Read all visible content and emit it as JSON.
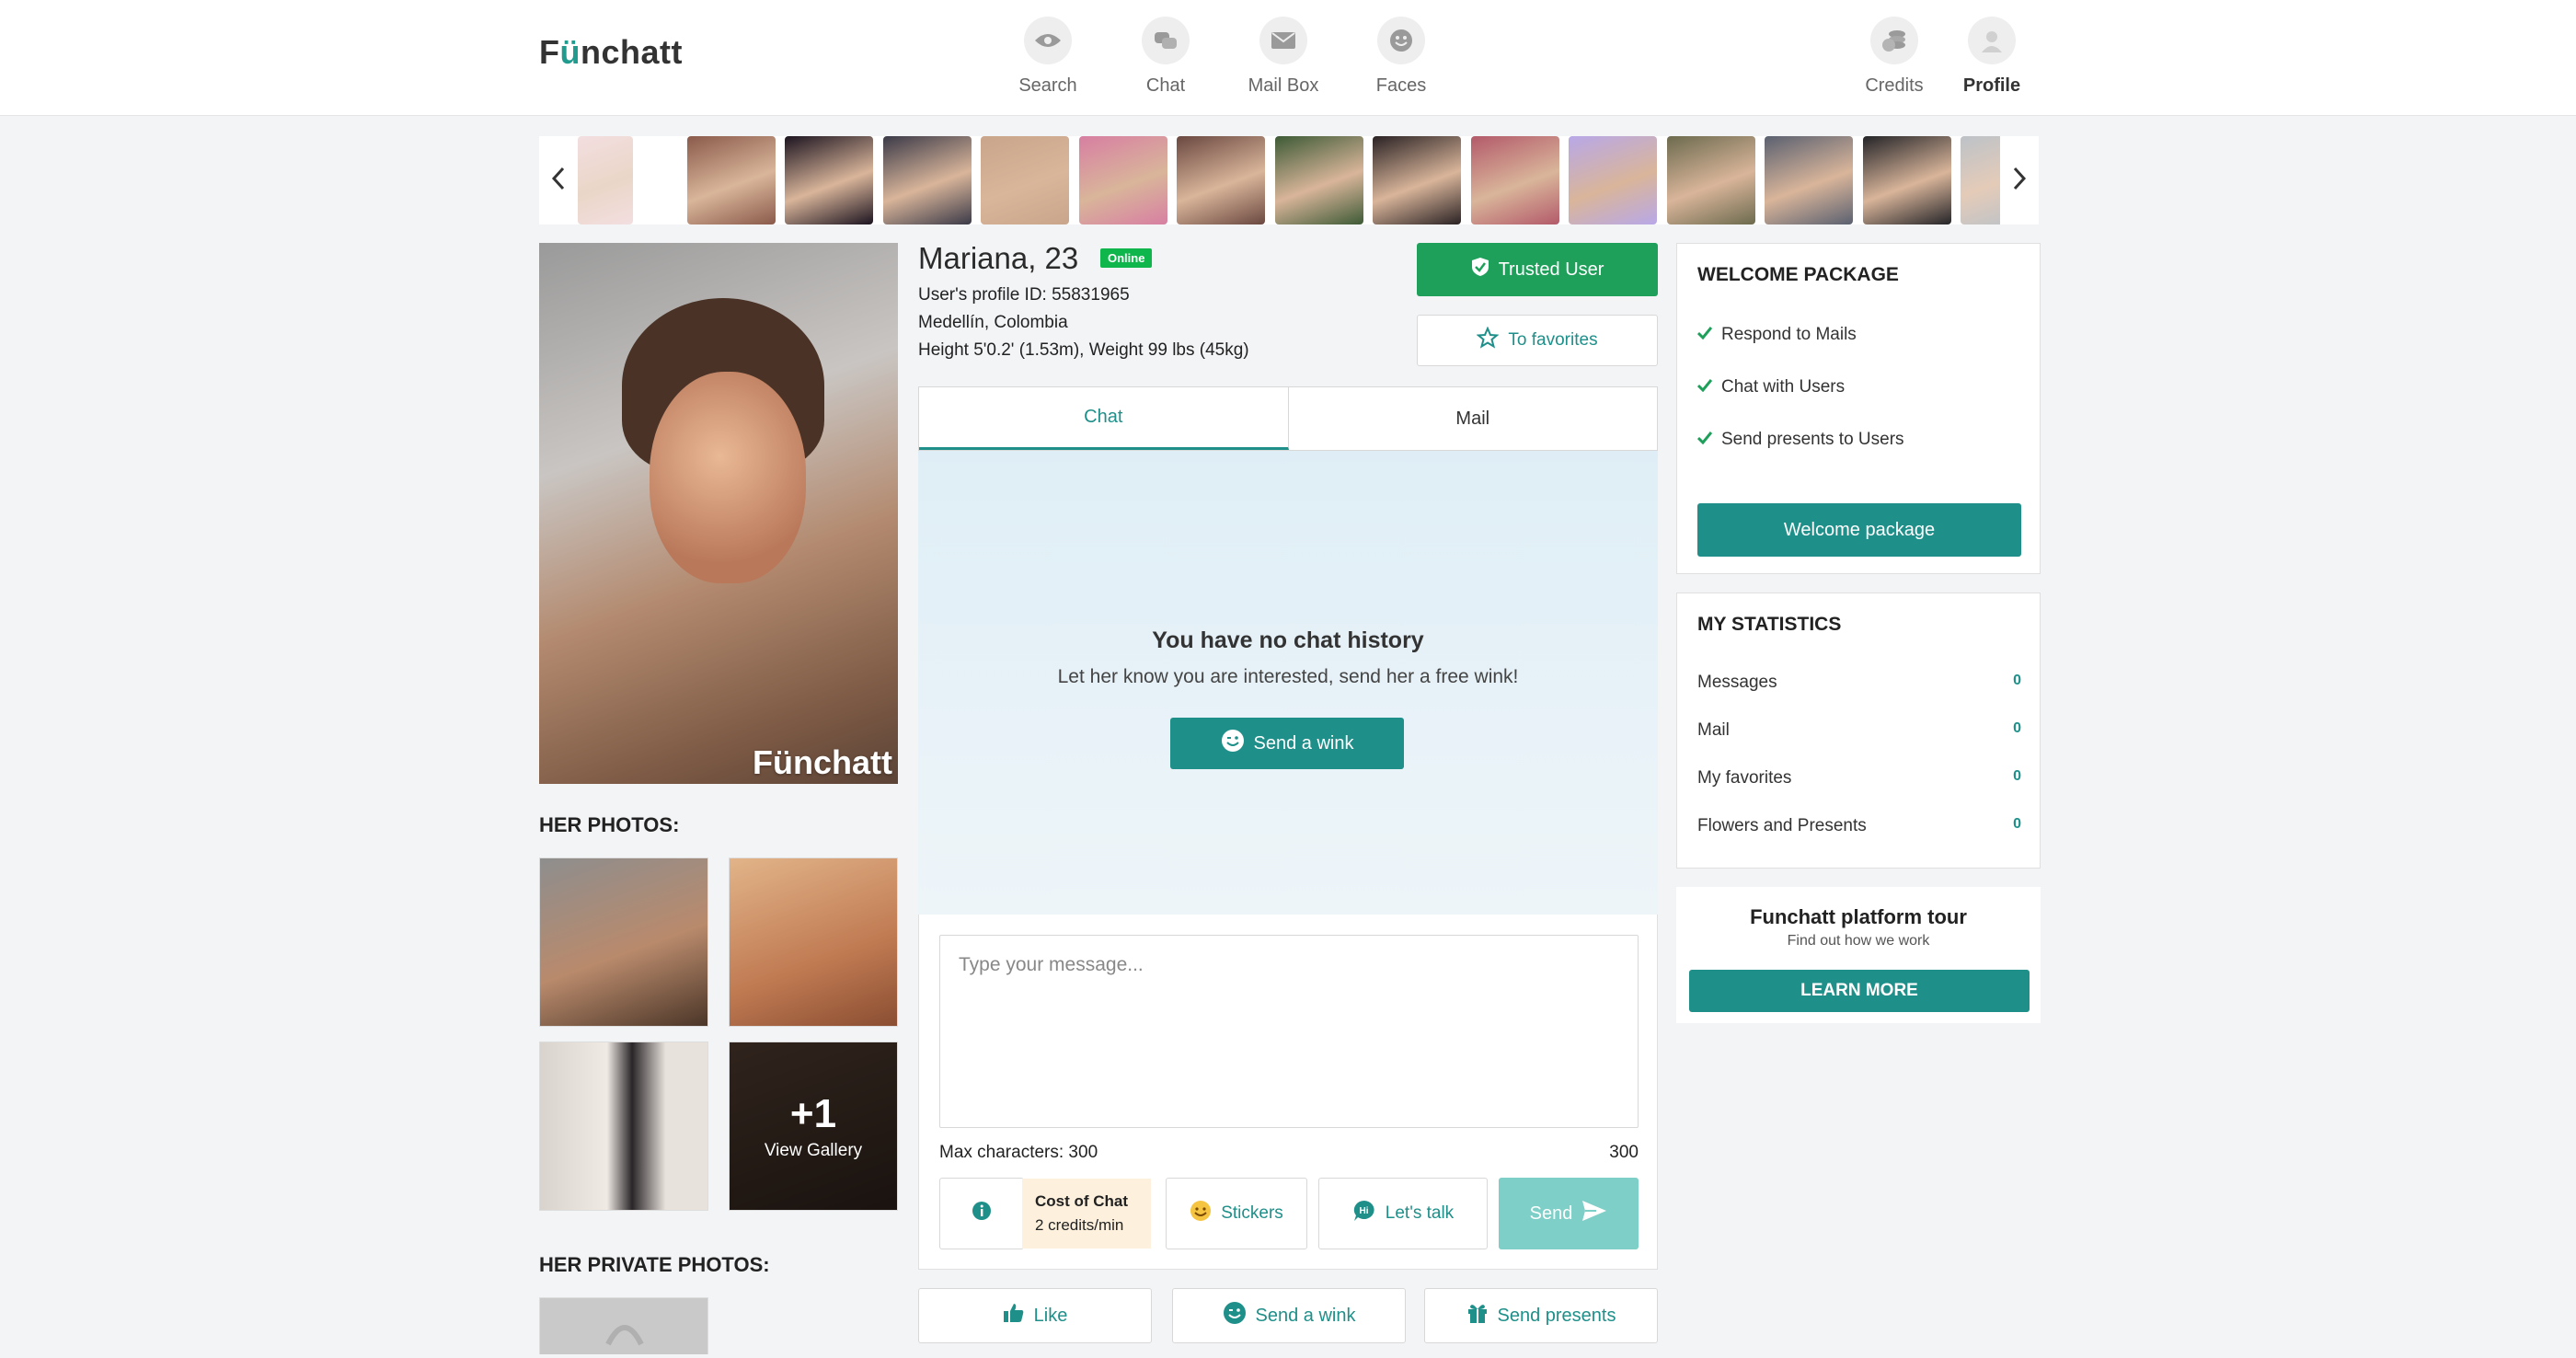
{
  "header": {
    "logo": {
      "before": "F",
      "u": "ü",
      "after": "nchatt"
    },
    "nav": [
      {
        "label": "Search",
        "icon": "eye-icon"
      },
      {
        "label": "Chat",
        "icon": "chat-bubbles-icon"
      },
      {
        "label": "Mail Box",
        "icon": "envelope-icon"
      },
      {
        "label": "Faces",
        "icon": "smiley-icon"
      }
    ],
    "right_nav": [
      {
        "label": "Credits",
        "icon": "coins-icon"
      },
      {
        "label": "Profile",
        "icon": "avatar-icon"
      }
    ]
  },
  "carousel": {
    "thumbnail_count": 15,
    "prev_icon": "chevron-left-icon",
    "next_icon": "chevron-right-icon",
    "thumbnail_colors": [
      "#e9c3c7",
      "#8a5a4a",
      "#1c1420",
      "#3b3a48",
      "#c9a58b",
      "#d77fa2",
      "#6a4840",
      "#3d5a36",
      "#2a2224",
      "#b35a6a",
      "#b8a8e8",
      "#6c6a4e",
      "#5a6070",
      "#242428",
      "#a0a8b0"
    ]
  },
  "profile": {
    "name": "Mariana, 23",
    "status": "Online",
    "profile_id": "User's profile ID: 55831965",
    "location": "Medellín, Colombia",
    "measurements": "Height 5'0.2' (1.53m), Weight 99 lbs (45kg)",
    "main_photo_watermark": "Fünchatt",
    "trusted_label": "Trusted User",
    "favorites_label": "To favorites"
  },
  "photos": {
    "title": "HER PHOTOS:",
    "more_count": "+1",
    "view_gallery": "View Gallery",
    "private_title": "HER PRIVATE PHOTOS:"
  },
  "tabs": [
    {
      "label": "Chat",
      "active": true
    },
    {
      "label": "Mail",
      "active": false
    }
  ],
  "chat": {
    "empty_title": "You have no chat history",
    "empty_sub": "Let her know you are interested, send her a free wink!",
    "wink_button": "Send a wink"
  },
  "composer": {
    "placeholder": "Type your message...",
    "max_chars_label": "Max characters: 300",
    "char_count": "300",
    "cost_title": "Cost of Chat",
    "cost_value": "2 credits/min",
    "stickers": "Stickers",
    "lets_talk": "Let's talk",
    "send": "Send"
  },
  "actions": {
    "like": "Like",
    "wink": "Send a wink",
    "presents": "Send presents"
  },
  "welcome": {
    "title": "WELCOME PACKAGE",
    "items": [
      "Respond to Mails",
      "Chat with Users",
      "Send presents to Users"
    ],
    "button": "Welcome package"
  },
  "stats": {
    "title": "MY STATISTICS",
    "items": [
      {
        "label": "Messages",
        "value": "0"
      },
      {
        "label": "Mail",
        "value": "0"
      },
      {
        "label": "My favorites",
        "value": "0"
      },
      {
        "label": "Flowers and Presents",
        "value": "0"
      }
    ]
  },
  "tour": {
    "title": "Funchatt platform tour",
    "subtitle": "Find out how we work",
    "button": "LEARN MORE"
  },
  "colors": {
    "accent": "#1f8f89",
    "trusted": "#1ea05a",
    "online": "#0fb64c",
    "send_disabled": "#7ecfc7",
    "cost_bg": "#fdf1dd"
  }
}
